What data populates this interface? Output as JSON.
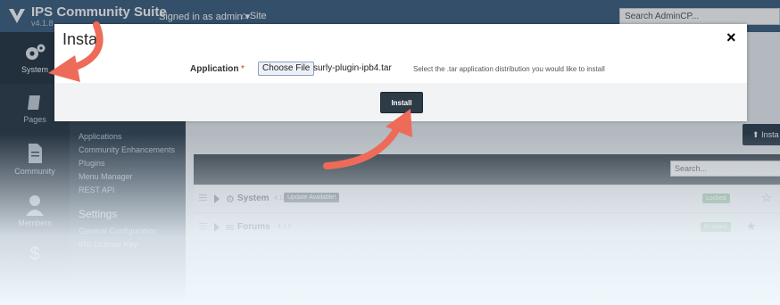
{
  "header": {
    "title": "IPS Community Suite",
    "version": "v4.1.8",
    "signed_in": "Signed in as admin",
    "site_link": "Site",
    "search_placeholder": "Search AdminCP..."
  },
  "sidebar": {
    "items": [
      {
        "label": "System",
        "icon": "gears-icon"
      },
      {
        "label": "Pages",
        "icon": "book-icon"
      },
      {
        "label": "Community",
        "icon": "document-icon"
      },
      {
        "label": "Members",
        "icon": "user-icon"
      }
    ]
  },
  "submenu": {
    "links": [
      "Applications",
      "Community Enhancements",
      "Plugins",
      "Menu Manager",
      "REST API"
    ],
    "settings_heading": "Settings",
    "settings_links": [
      "General Configuration",
      "IPS License Key"
    ]
  },
  "main": {
    "install_button": "Insta",
    "list_search_placeholder": "Search...",
    "apps": [
      {
        "name": "System",
        "version": "4.1.8",
        "badge": "Update Available!",
        "status": "Locked"
      },
      {
        "name": "Forums",
        "version": "4.1.8",
        "status": "Enabled"
      }
    ]
  },
  "modal": {
    "title": "Insta",
    "close": "×",
    "field_label": "Application",
    "required_marker": "*",
    "choose_file": "Choose File",
    "file_name": "surly-plugin-ipb4.tar",
    "hint": "Select the .tar application distribution you would like to install",
    "install_button": "Install"
  },
  "colors": {
    "topbar": "#3e5f7e",
    "sidebar": "#2c3a47",
    "accent_arrow": "#ee6b5a",
    "status_green": "#7fb784"
  }
}
